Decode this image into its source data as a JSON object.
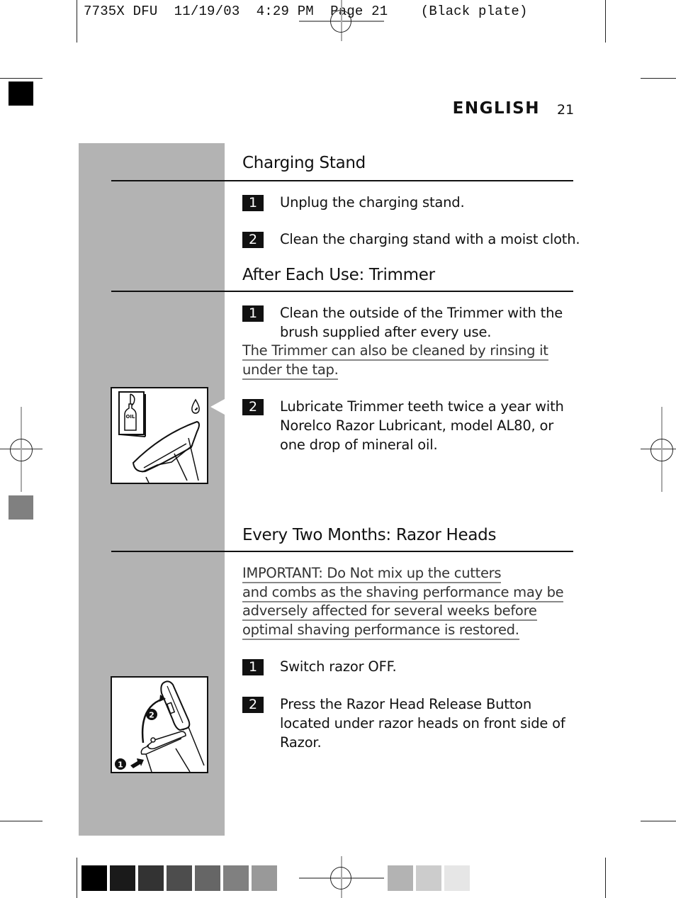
{
  "slug": {
    "job": "7735X DFU",
    "date": "11/19/03",
    "time": "4:29 PM",
    "page": "Page 21",
    "plate": "(Black plate)"
  },
  "header": {
    "language": "ENGLISH",
    "page_number": "21"
  },
  "sections": [
    {
      "title": "Charging Stand",
      "steps": [
        {
          "number": "1",
          "text": "Unplug the charging stand."
        },
        {
          "number": "2",
          "text": "Clean the charging stand with a moist cloth."
        }
      ]
    },
    {
      "title": "After Each Use: Trimmer",
      "steps": [
        {
          "number": "1",
          "lines": [
            "Clean the outside of the Trimmer with the",
            "brush supplied after every use."
          ]
        },
        {
          "number": "2",
          "lines": [
            "Lubricate Trimmer teeth twice a year with",
            "Norelco Razor Lubricant, model AL80, or",
            "one drop of mineral oil."
          ]
        }
      ],
      "note_lines": [
        "The Trimmer can also be cleaned by rinsing it",
        "under the tap."
      ],
      "figure": {
        "icon": "oil-bottle-trimmer-illustration",
        "label": "OIL"
      }
    },
    {
      "title": "Every Two Months: Razor Heads",
      "important_lines": [
        "IMPORTANT: Do Not mix up the cutters",
        "and combs as the shaving performance may be",
        "adversely affected for several weeks before",
        "optimal shaving performance is restored."
      ],
      "steps": [
        {
          "number": "1",
          "text": "Switch razor OFF."
        },
        {
          "number": "2",
          "lines": [
            "Press the Razor Head Release Button",
            "located under razor heads on front side of",
            "Razor."
          ]
        }
      ],
      "figure": {
        "icon": "razor-head-release-illustration",
        "callouts": [
          "1",
          "2"
        ]
      }
    }
  ],
  "color_bar": {
    "left_swatches": [
      "#000000",
      "#1a1a1a",
      "#333333",
      "#4d4d4d",
      "#666666",
      "#808080",
      "#999999"
    ],
    "right_swatches": [
      "#b3b3b3",
      "#cccccc",
      "#e6e6e6"
    ]
  },
  "marks": {
    "top_left_square": "#000000",
    "left_gray_square": "#808080",
    "column_gray": "#b3b3b3"
  }
}
